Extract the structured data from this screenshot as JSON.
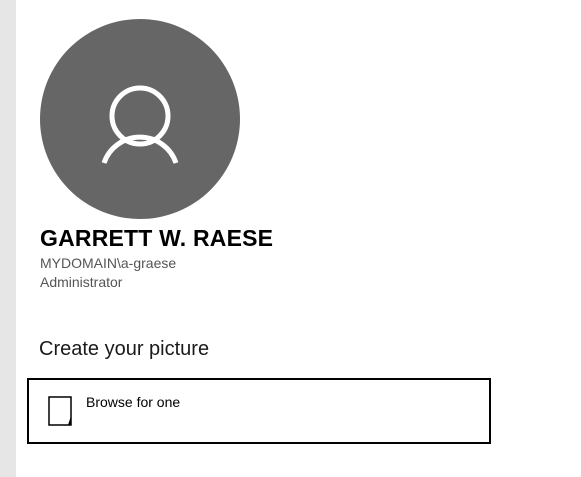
{
  "profile": {
    "avatar_icon": "user-silhouette-icon",
    "avatar_bg": "#666666",
    "name": "GARRETT W. RAESE",
    "account": "MYDOMAIN\\a-graese",
    "role": "Administrator"
  },
  "create_picture": {
    "heading": "Create your picture",
    "browse_label": "Browse for one",
    "browse_icon": "document-icon"
  }
}
